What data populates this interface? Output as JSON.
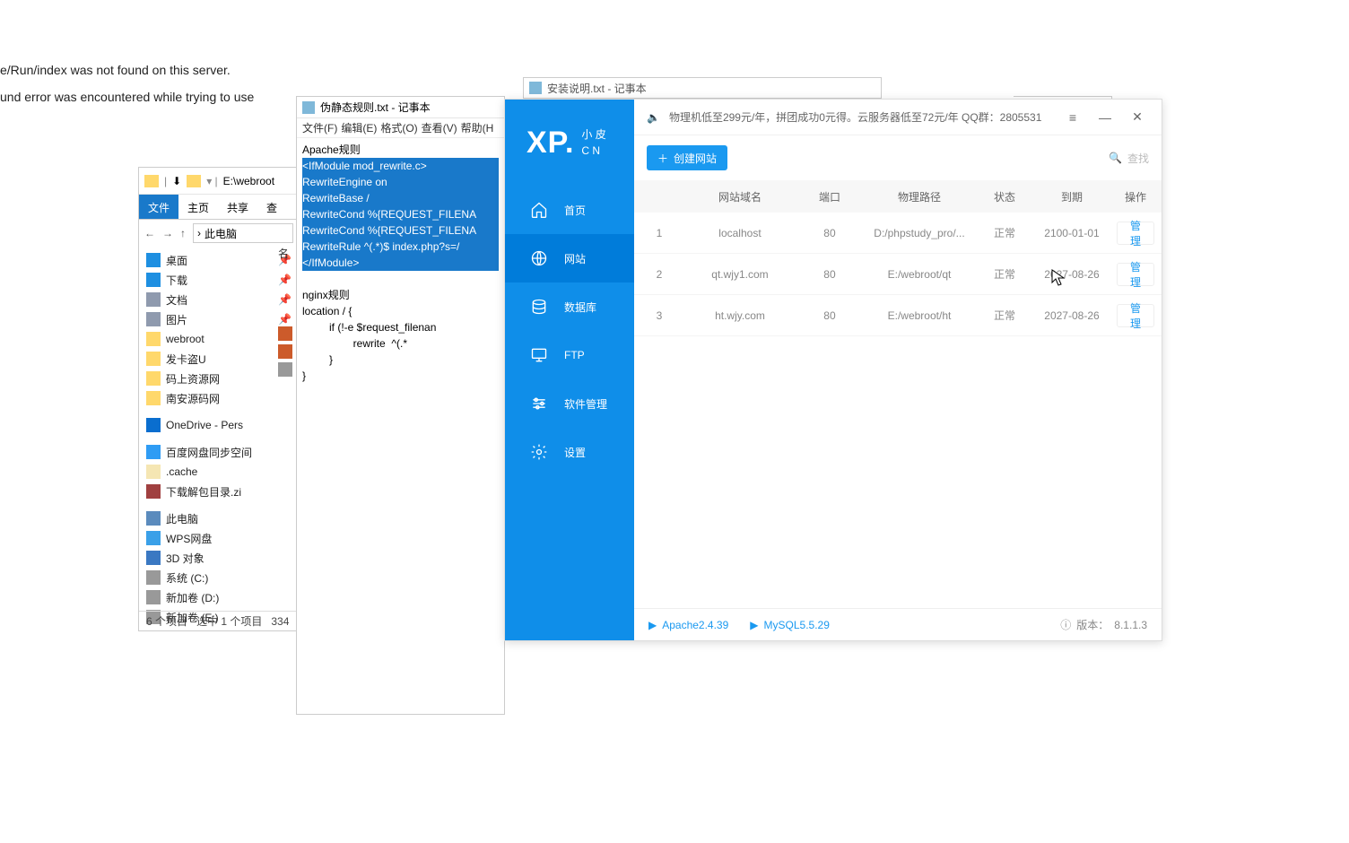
{
  "bg": {
    "err1": "e/Run/index was not found on this server.",
    "err2": "und error was encountered while trying to use"
  },
  "bg_notepad": {
    "title": "安装说明.txt - 记事本"
  },
  "explorer": {
    "path_label": "E:\\webroot",
    "tabs": {
      "file": "文件",
      "home": "主页",
      "share": "共享",
      "view": "查"
    },
    "addr_text": "此电脑",
    "tree": {
      "desktop": "桌面",
      "download": "下载",
      "document": "文档",
      "picture": "图片",
      "webroot": "webroot",
      "fakaU": "发卡盗U",
      "mshang": "码上资源网",
      "nanan": "南安源码网",
      "onedrive": "OneDrive - Pers",
      "baidu": "百度网盘同步空间",
      "cache": ".cache",
      "zip": "下载解包目录.zi",
      "pc": "此电脑",
      "wps": "WPS网盘",
      "d3": "3D 对象",
      "sys": "系统 (C:)",
      "nd": "新加卷 (D:)",
      "ne": "新加卷 (E:)"
    },
    "status": {
      "count": "6 个项目",
      "sel": "选中 1 个项目",
      "size": "334"
    },
    "col_header": "名"
  },
  "notepad": {
    "title": "伪静态规则.txt - 记事本",
    "menu": {
      "file": "文件(F)",
      "edit": "编辑(E)",
      "format": "格式(O)",
      "view": "查看(V)",
      "help": "帮助(H"
    },
    "body": {
      "l1": "Apache规则",
      "l2": "<IfModule mod_rewrite.c>",
      "l3": "RewriteEngine on",
      "l4": "RewriteBase /",
      "l5": "RewriteCond %{REQUEST_FILENA",
      "l6": "RewriteCond %{REQUEST_FILENA",
      "l7": "RewriteRule ^(.*)$ index.php?s=/",
      "l8": "</IfModule>",
      "l10": "nginx规则",
      "l11": "location / {",
      "l12": "         if (!-e $request_filenan",
      "l13": "                 rewrite  ^(.*",
      "l14": "         }",
      "l15": "}"
    },
    "win": {
      "min": "—",
      "max": "☐",
      "close": "✕"
    }
  },
  "xp": {
    "logo": {
      "big": "XP.",
      "sub1": "小 皮",
      "sub2": "C N"
    },
    "nav": {
      "home": "首页",
      "site": "网站",
      "db": "数据库",
      "ftp": "FTP",
      "soft": "软件管理",
      "setting": "设置"
    },
    "notice": "物理机低至299元/年，拼团成功0元得。云服务器低至72元/年  QQ群：2805531",
    "actions": {
      "create": "创建网站",
      "search": "查找"
    },
    "thead": {
      "domain": "网站域名",
      "port": "端口",
      "path": "物理路径",
      "status": "状态",
      "expire": "到期",
      "op": "操作"
    },
    "rows": [
      {
        "idx": "1",
        "domain": "localhost",
        "port": "80",
        "path": "D:/phpstudy_pro/...",
        "status": "正常",
        "expire": "2100-01-01",
        "op": "管理"
      },
      {
        "idx": "2",
        "domain": "qt.wjy1.com",
        "port": "80",
        "path": "E:/webroot/qt",
        "status": "正常",
        "expire": "2027-08-26",
        "op": "管理"
      },
      {
        "idx": "3",
        "domain": "ht.wjy.com",
        "port": "80",
        "path": "E:/webroot/ht",
        "status": "正常",
        "expire": "2027-08-26",
        "op": "管理"
      }
    ],
    "footer": {
      "apache": "Apache2.4.39",
      "mysql": "MySQL5.5.29",
      "ver_label": "版本：",
      "ver": "8.1.1.3"
    },
    "ctl": {
      "menu": "≡",
      "min": "—",
      "close": "✕"
    }
  }
}
